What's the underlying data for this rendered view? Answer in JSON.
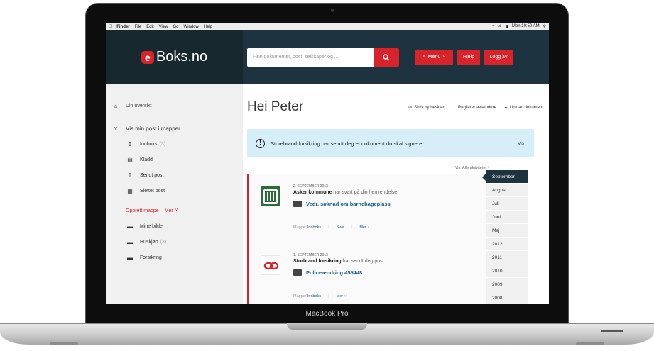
{
  "device": {
    "label": "MacBook Pro"
  },
  "menubar": {
    "apple": "",
    "items": [
      "Finder",
      "File",
      "Edit",
      "View",
      "Go",
      "Window",
      "Help"
    ],
    "clock": "Mon 10:50 AM"
  },
  "header": {
    "logo_letter": "e",
    "logo_text": "Boks.no",
    "search_placeholder": "Finn dokumenter, post, selskaper og ...",
    "menu_label": "Menu",
    "help_label": "Hjelp",
    "logout_label": "Logg av"
  },
  "sidebar": {
    "overview": "Din oversikt",
    "section": "Vis min post i mapper",
    "folders": [
      {
        "label": "Innboks",
        "count": "(3)",
        "icon": "inbox-icon"
      },
      {
        "label": "Kladd",
        "count": "",
        "icon": "draft-icon"
      },
      {
        "label": "Sendt post",
        "count": "",
        "icon": "sent-icon"
      },
      {
        "label": "Slettet post",
        "count": "",
        "icon": "trash-icon"
      }
    ],
    "create_folder": "Opprett mappe",
    "more": "Mer",
    "custom_folders": [
      {
        "label": "Mine bilder",
        "count": ""
      },
      {
        "label": "Huskjøp",
        "count": "(3)"
      },
      {
        "label": "Forsikring",
        "count": ""
      }
    ]
  },
  "main": {
    "greeting": "Hei Peter",
    "actions": [
      "Skriv ny beskjed",
      "Registrer avsendere",
      "Upload dokument"
    ],
    "notice": {
      "text": "Storebrand forsikring har sendt deg et dokument du skal signere",
      "link": "Vis"
    },
    "filter": "Vis: Alle aktiviteter",
    "cards": [
      {
        "date": "2. SEPTEMBER 2013",
        "sender": "Asker kommune",
        "action": "har svart på din henvendelse:",
        "document": "Vedr. søknad om barnehageplass",
        "folder_label": "Mappe:",
        "folder": "Innboks",
        "reply": "Svar",
        "more": "Mer"
      },
      {
        "date": "1. SEPTEMBER 2013",
        "sender": "Storbrand forsikring",
        "action": "har sendt deg post:",
        "document": "Policeændring 455448",
        "folder_label": "Mappe:",
        "folder": "Innboks",
        "reply": "",
        "more": "Mer"
      }
    ],
    "timeline": [
      "September",
      "August",
      "Juli",
      "Juni",
      "Maj",
      "2012",
      "2011",
      "2010",
      "2009",
      "2008"
    ]
  },
  "colors": {
    "brand_red": "#d9232b",
    "header_bg": "#1e3340",
    "notice_bg": "#d6eef8",
    "link": "#1a5f8c"
  }
}
